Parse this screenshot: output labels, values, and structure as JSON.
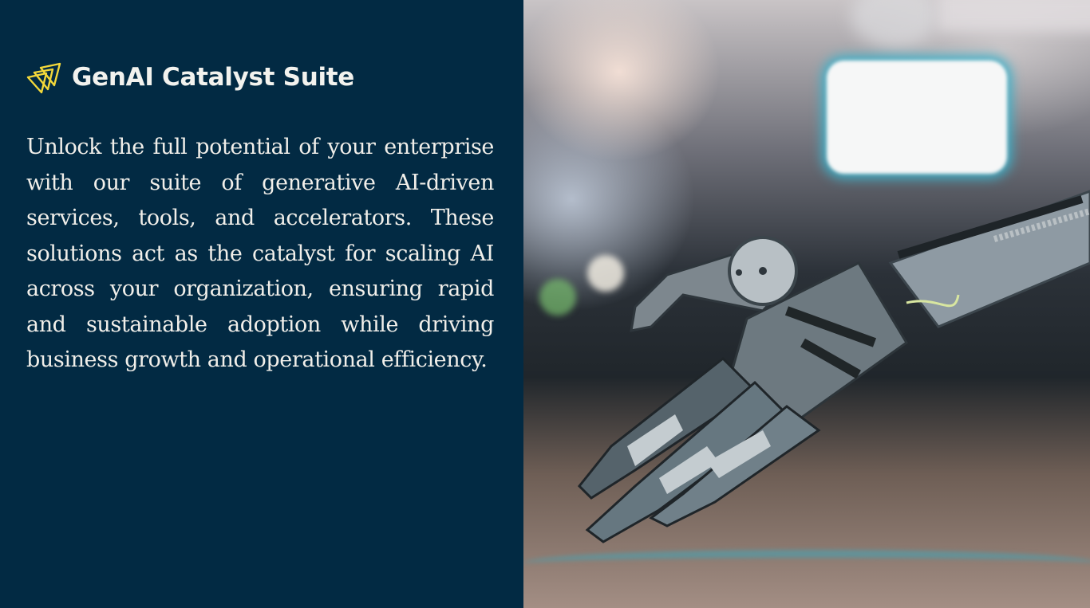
{
  "brand": {
    "title": "GenAI Catalyst Suite",
    "logo_icon": "layered-triangles-icon",
    "logo_color": "#f3d83a"
  },
  "description": "Unlock the full potential of your enterprise with our suite of generative AI-driven services, tools, and accelerators. These solutions act as the catalyst for scaling AI across your organization, ensuring rapid and sustainable adoption while driving business growth and operational efficiency.",
  "hero_image": {
    "alt": "Robotic hand with blurred background"
  },
  "colors": {
    "panel_background": "#022a43",
    "text": "#f1efea",
    "accent": "#f3d83a"
  }
}
